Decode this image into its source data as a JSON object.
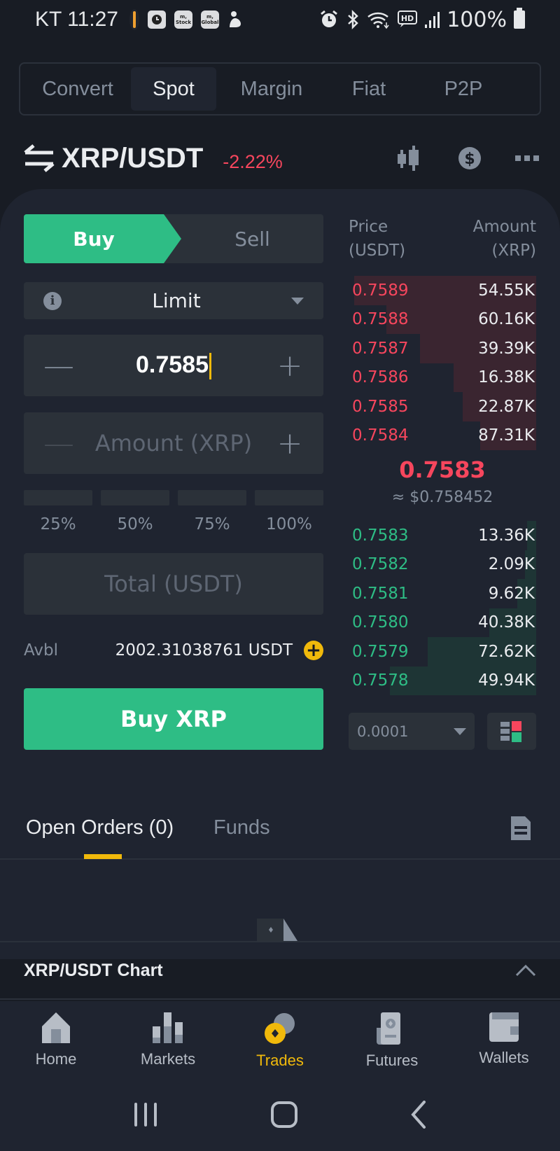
{
  "status_bar": {
    "carrier_time": "KT 11:27",
    "app_icons": [
      "walker-icon",
      "clock-app-icon",
      "m-stock-icon",
      "m-global-icon",
      "baby-icon"
    ],
    "app_labels": {
      "m_stock": "m,\nStock",
      "m_global": "m,\nGlobal"
    },
    "battery": "100%"
  },
  "top_tabs": [
    {
      "label": "Convert",
      "active": false
    },
    {
      "label": "Spot",
      "active": true
    },
    {
      "label": "Margin",
      "active": false
    },
    {
      "label": "Fiat",
      "active": false
    },
    {
      "label": "P2P",
      "active": false
    }
  ],
  "pair": {
    "name": "XRP/USDT",
    "change": "-2.22%"
  },
  "trade_form": {
    "buy_label": "Buy",
    "sell_label": "Sell",
    "order_type": "Limit",
    "price_value": "0.7585",
    "amount_placeholder": "Amount (XRP)",
    "percent_options": [
      "25%",
      "50%",
      "75%",
      "100%"
    ],
    "total_placeholder": "Total (USDT)",
    "avbl_label": "Avbl",
    "avbl_value": "2002.31038761 USDT",
    "submit_label": "Buy XRP"
  },
  "order_book": {
    "price_header": [
      "Price",
      "(USDT)"
    ],
    "amount_header": [
      "Amount",
      "(XRP)"
    ],
    "asks": [
      {
        "price": "0.7589",
        "amount": "54.55K",
        "depth": 0.97
      },
      {
        "price": "0.7588",
        "amount": "60.16K",
        "depth": 0.8
      },
      {
        "price": "0.7587",
        "amount": "39.39K",
        "depth": 0.62
      },
      {
        "price": "0.7586",
        "amount": "16.38K",
        "depth": 0.44
      },
      {
        "price": "0.7585",
        "amount": "22.87K",
        "depth": 0.39
      },
      {
        "price": "0.7584",
        "amount": "87.31K",
        "depth": 0.3
      }
    ],
    "last_price": "0.7583",
    "last_price_usd": "≈ $0.758452",
    "bids": [
      {
        "price": "0.7583",
        "amount": "13.36K",
        "depth": 0.05
      },
      {
        "price": "0.7582",
        "amount": "2.09K",
        "depth": 0.06
      },
      {
        "price": "0.7581",
        "amount": "9.62K",
        "depth": 0.1
      },
      {
        "price": "0.7580",
        "amount": "40.38K",
        "depth": 0.25
      },
      {
        "price": "0.7579",
        "amount": "72.62K",
        "depth": 0.58
      },
      {
        "price": "0.7578",
        "amount": "49.94K",
        "depth": 0.78
      }
    ],
    "tick_size": "0.0001"
  },
  "orders_section": {
    "open_orders_label": "Open Orders (0)",
    "funds_label": "Funds"
  },
  "chart_bar": {
    "title": "XRP/USDT Chart"
  },
  "bottom_nav": [
    {
      "label": "Home",
      "icon": "home-icon",
      "active": false
    },
    {
      "label": "Markets",
      "icon": "markets-icon",
      "active": false
    },
    {
      "label": "Trades",
      "icon": "trades-icon",
      "active": true
    },
    {
      "label": "Futures",
      "icon": "futures-icon",
      "active": false
    },
    {
      "label": "Wallets",
      "icon": "wallets-icon",
      "active": false
    }
  ],
  "colors": {
    "buy_green": "#2ebd85",
    "sell_red": "#f6465d",
    "accent_yellow": "#f0b90b"
  }
}
